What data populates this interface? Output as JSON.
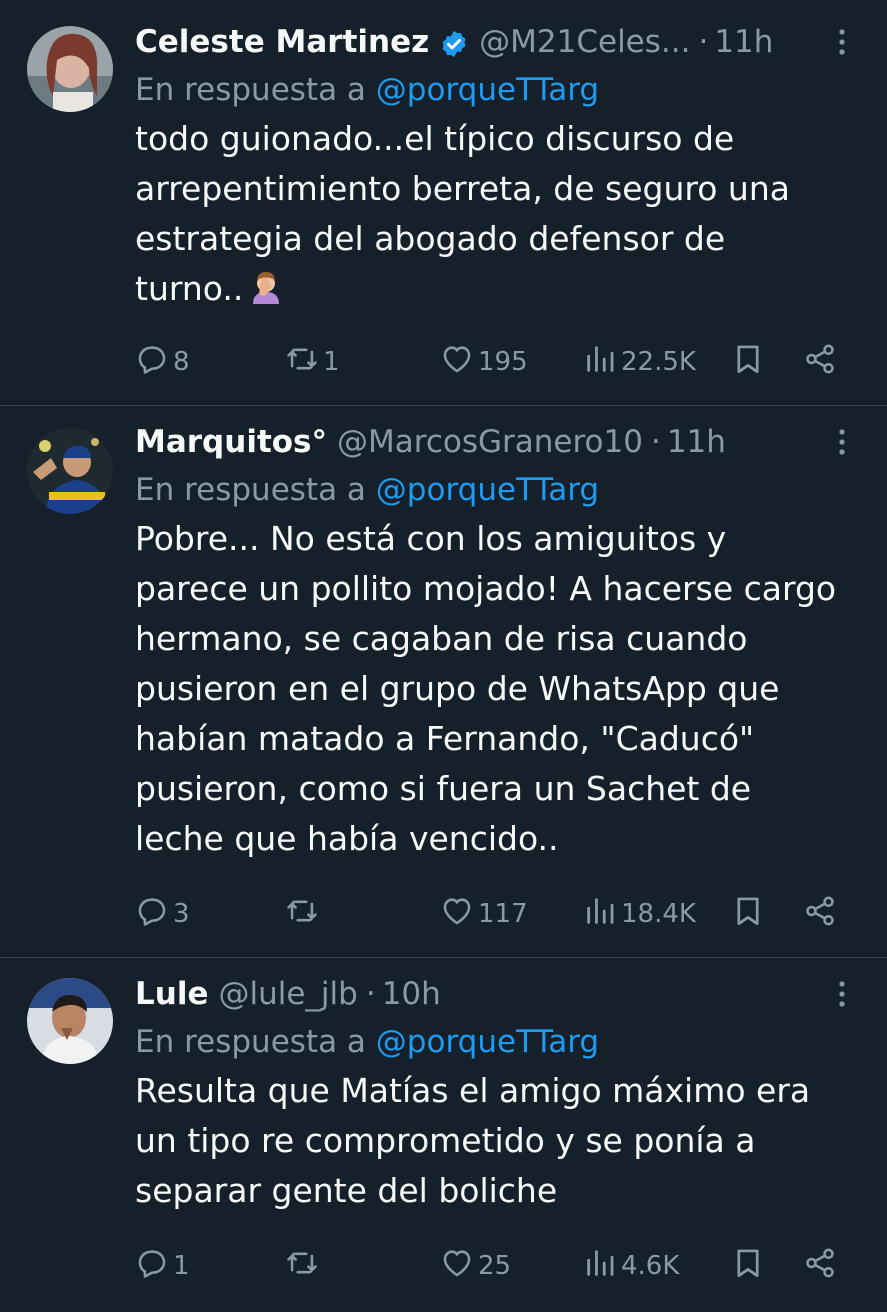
{
  "colors": {
    "background": "#15202b",
    "text": "#f7f9f9",
    "secondary": "#8b98a5",
    "accent": "#1d9bf0",
    "divider": "#38444d"
  },
  "tweets": [
    {
      "name": "Celeste Martinez",
      "verified": true,
      "handle": "@M21Celes...",
      "dot": "·",
      "time": "11h",
      "reply_prefix": "En respuesta a",
      "reply_mention": "@porqueTTarg",
      "lines": [
        "todo guionado...el típico discurso de",
        "arrepentimiento berreta, de seguro una",
        "estrategia del abogado defensor de",
        "turno.."
      ],
      "emoji": "facepalm-emoji",
      "replies": "8",
      "retweets": "1",
      "likes": "195",
      "views": "22.5K"
    },
    {
      "name": "Marquitos°",
      "verified": false,
      "handle": "@MarcosGranero10",
      "dot": "·",
      "time": "11h",
      "reply_prefix": "En respuesta a",
      "reply_mention": "@porqueTTarg",
      "lines": [
        "Pobre... No está con los amiguitos y",
        "parece un pollito mojado! A hacerse cargo",
        "hermano, se cagaban de risa cuando",
        "pusieron en el grupo de WhatsApp que",
        "habían matado a Fernando, \"Caducó\"",
        "pusieron, como si fuera un Sachet de",
        "leche que había vencido.."
      ],
      "replies": "3",
      "retweets": "",
      "likes": "117",
      "views": "18.4K"
    },
    {
      "name": "Lule",
      "verified": false,
      "handle": "@lule_jlb",
      "dot": "·",
      "time": "10h",
      "reply_prefix": "En respuesta a",
      "reply_mention": "@porqueTTarg",
      "lines": [
        "Resulta que Matías el amigo máximo era",
        "un tipo re comprometido y se ponía a",
        "separar gente del boliche"
      ],
      "replies": "1",
      "retweets": "",
      "likes": "25",
      "views": "4.6K"
    }
  ]
}
